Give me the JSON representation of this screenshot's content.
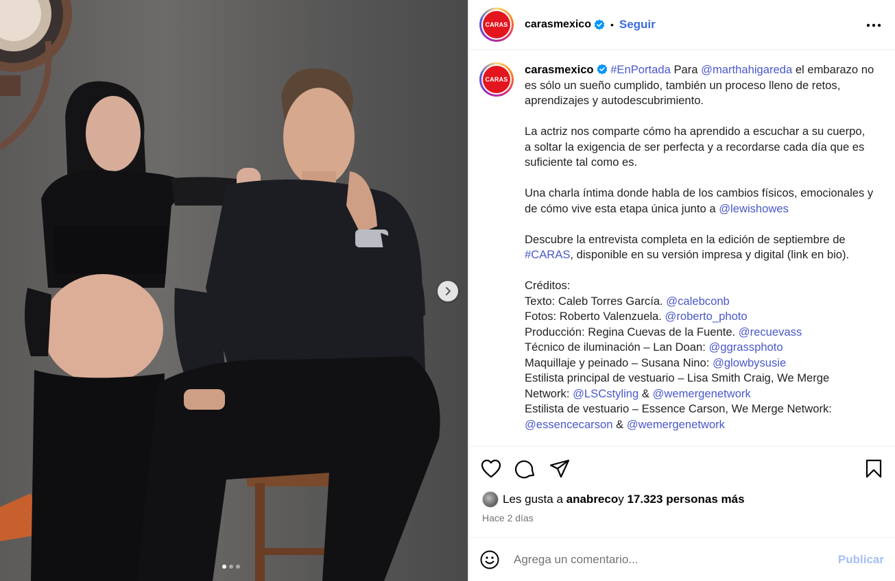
{
  "account": {
    "avatar_text": "CARAS",
    "username": "carasmexico",
    "separator": "•",
    "follow_label": "Seguir"
  },
  "caption": {
    "username": "carasmexico",
    "hashtag_portada": "#EnPortada",
    "p1_a": " Para ",
    "mention_martha": "@marthahigareda",
    "p1_b": " el embarazo no es sólo un sueño cumplido, también un proceso lleno de retos, aprendizajes y autodescubrimiento.",
    "p2": "La actriz nos comparte cómo ha aprendido a escuchar a su cuerpo, a soltar la exigencia de ser perfecta y a recordarse cada día que es suficiente tal como es.",
    "p3": "Una charla íntima donde habla de los cambios físicos, emocionales y de cómo vive esta etapa única junto a ",
    "mention_lewis": "@lewishowes",
    "p4_a": "Descubre la entrevista completa en la edición de septiembre de ",
    "hashtag_caras": "#CARAS",
    "p4_b": ", disponible en su versión impresa y digital (link en bio).",
    "credits_title": "Créditos:",
    "credits": [
      {
        "text": "Texto: Caleb Torres García. ",
        "mentions": [
          "@calebconb"
        ]
      },
      {
        "text": "Fotos: Roberto Valenzuela. ",
        "mentions": [
          "@roberto_photo"
        ]
      },
      {
        "text": "Producción: Regina Cuevas de la Fuente. ",
        "mentions": [
          "@recuevass"
        ]
      },
      {
        "text": "Técnico de iluminación – Lan Doan: ",
        "mentions": [
          "@ggrassphoto"
        ]
      },
      {
        "text": "Maquillaje y peinado – Susana Nino: ",
        "mentions": [
          "@glowbysusie"
        ]
      },
      {
        "text": "Estilista principal de vestuario – Lisa Smith Craig, We Merge Network: ",
        "mentions": [
          "@LSCstyling",
          "@wemergenetwork"
        ]
      },
      {
        "text": "Estilista de vestuario – Essence Carson, We Merge Network: ",
        "mentions": [
          "@essencecarson",
          "@wemergenetwork"
        ]
      }
    ],
    "amp": " & "
  },
  "engagement": {
    "likes_prefix": "Les gusta a ",
    "liker": "anabreco",
    "likes_mid": " y ",
    "likes_count": "17.323 personas más",
    "time": "Hace 2 días"
  },
  "comment": {
    "placeholder": "Agrega un comentario...",
    "publish_label": "Publicar"
  },
  "carousel": {
    "total_slides": 3,
    "active_slide": 1
  },
  "colors": {
    "link": "#4a58c7",
    "follow": "#3b6de0",
    "brand": "#e3161f",
    "publish_disabled": "#a7bff5"
  }
}
